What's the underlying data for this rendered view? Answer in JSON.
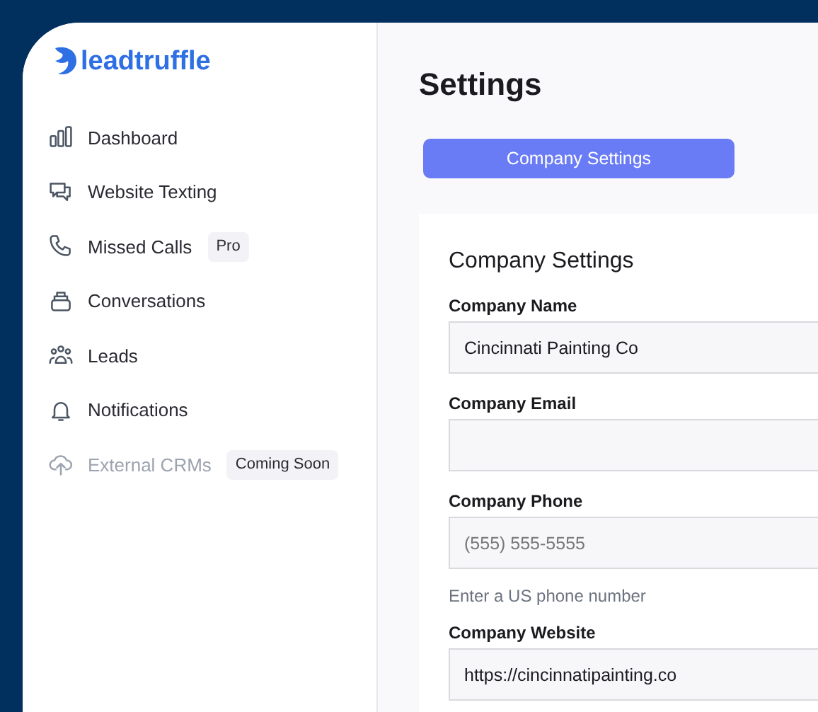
{
  "logo": {
    "text": "leadtruffle"
  },
  "sidebar": {
    "items": [
      {
        "label": "Dashboard",
        "disabled": false
      },
      {
        "label": "Website Texting",
        "disabled": false
      },
      {
        "label": "Missed Calls",
        "disabled": false,
        "badge": "Pro"
      },
      {
        "label": "Conversations",
        "disabled": false
      },
      {
        "label": "Leads",
        "disabled": false
      },
      {
        "label": "Notifications",
        "disabled": false
      },
      {
        "label": "External CRMs",
        "disabled": true,
        "badge": "Coming Soon"
      }
    ]
  },
  "page_title": "Settings",
  "tabs": [
    {
      "label": "Company Settings",
      "selected": true
    }
  ],
  "card": {
    "title": "Company Settings",
    "fields": [
      {
        "label": "Company Name",
        "value": "Cincinnati Painting Co"
      },
      {
        "label": "Company Email"
      },
      {
        "label": "Company Phone",
        "placeholder": "(555) 555-5555",
        "hint": "Enter a US phone number"
      },
      {
        "label": "Company Website",
        "value": "https://cincinnatipainting.co"
      }
    ]
  }
}
